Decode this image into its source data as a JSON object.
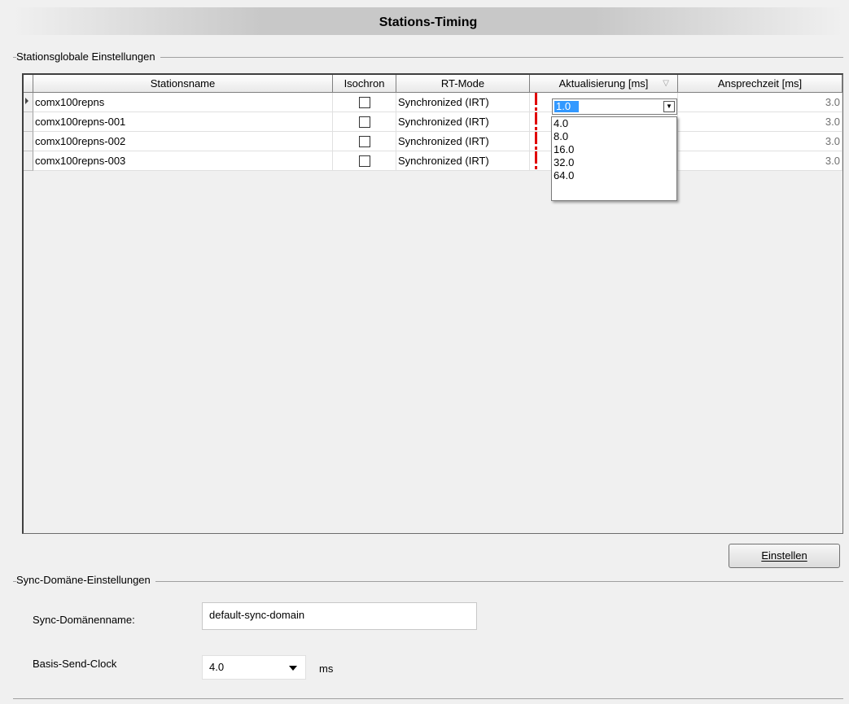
{
  "title": "Stations-Timing",
  "stations_group": {
    "label": "Stationsglobale Einstellungen",
    "columns": [
      "Stationsname",
      "Isochron",
      "RT-Mode",
      "Aktualisierung [ms]",
      "Ansprechzeit [ms]"
    ],
    "rows": [
      {
        "name": "comx100repns",
        "rt_mode": "Synchronized (IRT)",
        "update": "1.0",
        "response": "3.0"
      },
      {
        "name": "comx100repns-001",
        "rt_mode": "Synchronized (IRT)",
        "update": "",
        "response": "3.0"
      },
      {
        "name": "comx100repns-002",
        "rt_mode": "Synchronized (IRT)",
        "update": "",
        "response": "3.0"
      },
      {
        "name": "comx100repns-003",
        "rt_mode": "Synchronized (IRT)",
        "update": "",
        "response": "3.0"
      }
    ],
    "dropdown_options": [
      "4.0",
      "8.0",
      "16.0",
      "32.0",
      "64.0"
    ],
    "apply_button": "Einstellen"
  },
  "sync_group": {
    "label": "Sync-Domäne-Einstellungen",
    "name_label": "Sync-Domänenname:",
    "name_value": "default-sync-domain",
    "clock_label": "Basis-Send-Clock",
    "clock_value": "4.0",
    "clock_unit": "ms"
  },
  "colors": {
    "warning_mark": "#e00000",
    "selection": "#3399ff"
  }
}
